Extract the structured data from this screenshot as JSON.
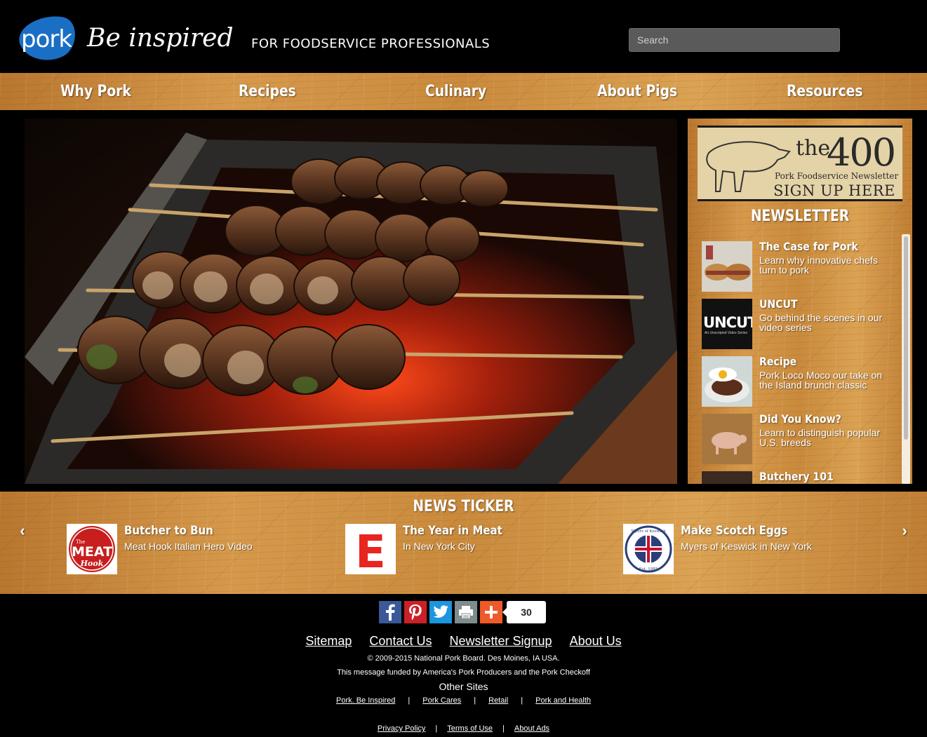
{
  "header": {
    "logo_text": "pork",
    "tagline": "Be inspired",
    "subtagline": "FOR FOODSERVICE PROFESSIONALS",
    "search_placeholder": "Search"
  },
  "nav": {
    "items": [
      {
        "label": "Why Pork"
      },
      {
        "label": "Recipes"
      },
      {
        "label": "Culinary"
      },
      {
        "label": "About Pigs"
      },
      {
        "label": "Resources"
      }
    ]
  },
  "sidebar": {
    "ad": {
      "the": "the",
      "number": "400",
      "subtitle": "Pork Foodservice Newsletter",
      "cta": "SIGN UP HERE"
    },
    "heading": "NEWSLETTER",
    "items": [
      {
        "title": "The Case for Pork",
        "desc": "Learn why innovative chefs turn to pork"
      },
      {
        "title": "UNCUT",
        "desc": "Go behind the scenes in our video series",
        "thumb_text": "UNCUT",
        "thumb_sub": "An Unscripted Video Series"
      },
      {
        "title": "Recipe",
        "desc": "Pork Loco Moco our take on the Island brunch classic"
      },
      {
        "title": "Did You Know?",
        "desc": "Learn to distinguish popular U.S. breeds"
      },
      {
        "title": "Butchery 101",
        "desc": ""
      }
    ]
  },
  "ticker": {
    "heading": "NEWS TICKER",
    "items": [
      {
        "title": "Butcher to Bun",
        "sub": "Meat Hook Italian Hero Video",
        "logo_top": "The",
        "logo_main": "MEAT",
        "logo_bottom": "Hook"
      },
      {
        "title": "The Year in Meat",
        "sub": "In New York City",
        "logo_main": "E"
      },
      {
        "title": "Make Scotch Eggs",
        "sub": "Myers of Keswick in New York",
        "logo_top": "Myers of Keswick",
        "logo_bottom": "Est. 1985"
      }
    ]
  },
  "share": {
    "count": "30",
    "buttons": [
      "facebook-icon",
      "pinterest-icon",
      "twitter-icon",
      "print-icon",
      "plus-icon"
    ]
  },
  "footer": {
    "links": [
      "Sitemap",
      "Contact Us",
      "Newsletter Signup",
      "About Us"
    ],
    "copyright": "© 2009-2015 National Pork Board. Des Moines, IA USA.",
    "funded": "This message funded by America's Pork Producers and the Pork Checkoff",
    "other_sites_label": "Other Sites",
    "other_sites": [
      "Pork. Be Inspired",
      "Pork Cares",
      "Retail",
      "Pork and Health"
    ],
    "separator": "|",
    "legal": [
      "Privacy Policy",
      "Terms of Use",
      "About Ads"
    ]
  },
  "colors": {
    "brand_blue": "#1a6fc4",
    "wood": "#c98a3c",
    "background": "#000000",
    "facebook": "#3b5998",
    "pinterest": "#cb2027",
    "twitter": "#1b95e0",
    "print": "#7f8c8d",
    "plus": "#f05a28"
  }
}
